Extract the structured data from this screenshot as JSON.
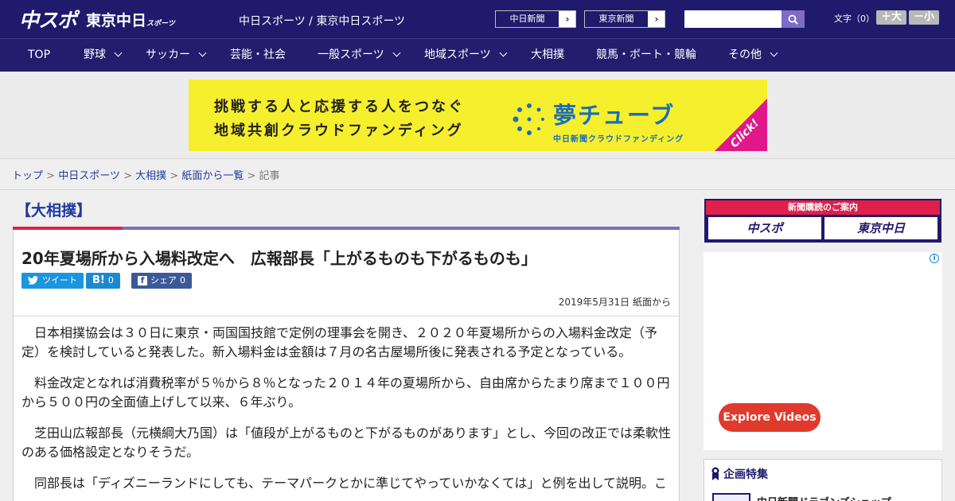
{
  "header": {
    "logo_main": "中スポ",
    "logo_sub": "東京中日",
    "logo_sub_small": "スポーツ",
    "site_links": "中日スポーツ / 東京中日スポーツ",
    "paper_buttons": [
      "中日新聞",
      "東京新聞"
    ],
    "paper_arrow": "›",
    "search_placeholder": "",
    "fontsize_label": "文字（0）",
    "fontsize_plus": "＋大",
    "fontsize_minus": "－小"
  },
  "nav": {
    "items": [
      {
        "label": "TOP",
        "dropdown": false
      },
      {
        "label": "野球",
        "dropdown": true
      },
      {
        "label": "サッカー",
        "dropdown": true
      },
      {
        "label": "芸能・社会",
        "dropdown": false
      },
      {
        "label": "一般スポーツ",
        "dropdown": true
      },
      {
        "label": "地域スポーツ",
        "dropdown": true
      },
      {
        "label": "大相撲",
        "dropdown": false
      },
      {
        "label": "競馬・ボート・競輪",
        "dropdown": false
      },
      {
        "label": "その他",
        "dropdown": true
      }
    ]
  },
  "banner": {
    "line1": "挑戦する人と応援する人をつなぐ",
    "line2": "地域共創クラウドファンディング",
    "brand": "夢チューブ",
    "brand_sub": "中日新聞クラウドファンディング",
    "click": "Click!",
    "color": "#f6ef2e",
    "accent": "#e0188a"
  },
  "breadcrumb": {
    "items": [
      "トップ",
      "中日スポーツ",
      "大相撲",
      "紙面から一覧"
    ],
    "current": "記事",
    "separator": ">"
  },
  "article": {
    "section": "【大相撲】",
    "headline": "20年夏場所から入場料改定へ　広報部長「上がるものも下がるものも」",
    "share": {
      "tweet": "ツイート",
      "hatena": "B!",
      "hatena_count": "0",
      "facebook": "シェア",
      "facebook_count": "0"
    },
    "date": "2019年5月31日 紙面から",
    "paragraphs": [
      "日本相撲協会は３０日に東京・両国国技館で定例の理事会を開き、２０２０年夏場所からの入場料金改定（予定）を検討していると発表した。新入場料金は金額は７月の名古屋場所後に発表される予定となっている。",
      "料金改定となれば消費税率が５％から８％となった２０１４年の夏場所から、自由席からたまり席まで１００円から５００円の全面値上げして以来、６年ぶり。",
      "芝田山広報部長（元横綱大乃国）は「値段が上がるものと下がるものがあります」とし、今回の改正では柔軟性のある価格設定となりそうだ。",
      "同部長は「ディズニーランドにしても、テーマパークとかに準じてやっていかなくては」と例を出して説明。こ"
    ]
  },
  "sidebar": {
    "subscribe_head": "新聞購読のご案内",
    "subscribe_buttons": [
      "中スポ",
      "東京中日"
    ],
    "ad_info": "i",
    "explore": "Explore Videos",
    "feature_title": "企画特集",
    "feature_item": "中日新聞ドラゴンズショップ"
  }
}
